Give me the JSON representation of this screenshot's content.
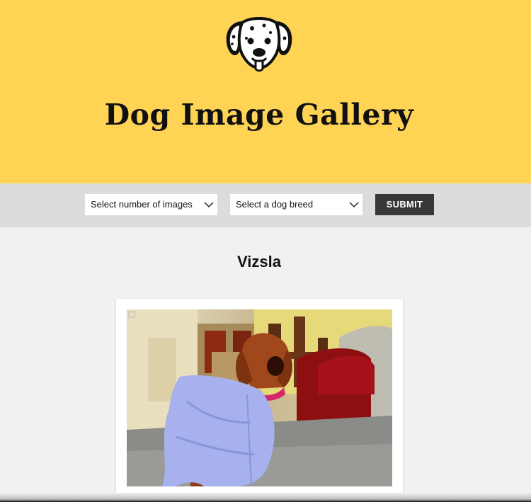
{
  "header": {
    "logo_icon": "dalmatian-dog-face-icon",
    "title": "Dog Image Gallery",
    "background": "#ffd455"
  },
  "controls": {
    "number_select": {
      "selected": "Select number of images"
    },
    "breed_select": {
      "selected": "Select a dog breed"
    },
    "submit_label": "SUBMIT"
  },
  "gallery": {
    "breed_name": "Vizsla",
    "images": [
      {
        "subject": "vizsla-dog-in-blue-shirt-photo"
      }
    ]
  }
}
